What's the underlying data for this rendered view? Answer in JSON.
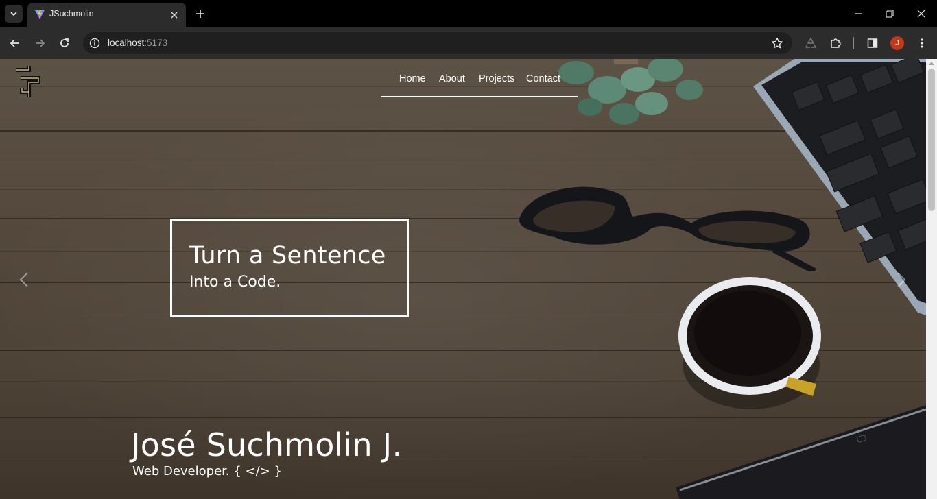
{
  "browser": {
    "tab": {
      "title": "JSuchmolin"
    },
    "address": {
      "host": "localhost",
      "port": ":5173"
    },
    "profile_initial": "J"
  },
  "site": {
    "nav": {
      "items": [
        "Home",
        "About",
        "Projects",
        "Contact"
      ]
    },
    "hero": {
      "tagline_line1": "Turn a Sentence",
      "tagline_line2": "Into a Code.",
      "name": "José Suchmolin J.",
      "role": "Web Developer. { </> }"
    }
  },
  "colors": {
    "chrome_bg": "#000000",
    "toolbar_bg": "#2c2c2c",
    "omnibox_bg": "#1f1f1f",
    "profile_badge": "#c5371c",
    "hero_text": "#ffffff",
    "wood": "#55493d"
  },
  "icons": {
    "tab_list": "chevron-down-icon",
    "favicon": "vite-logo-icon",
    "tab_close": "close-icon",
    "new_tab": "plus-icon",
    "window": [
      "minimize-icon",
      "restore-icon",
      "close-icon"
    ],
    "nav": [
      "back-arrow-icon",
      "forward-arrow-icon",
      "reload-icon"
    ],
    "site_info": "info-icon",
    "bookmark": "star-icon",
    "toolbar": [
      "recycle-icon",
      "extensions-puzzle-icon",
      "side-panel-icon",
      "kebab-menu-icon"
    ],
    "carousel": [
      "chevron-left-icon",
      "chevron-right-icon"
    ]
  }
}
